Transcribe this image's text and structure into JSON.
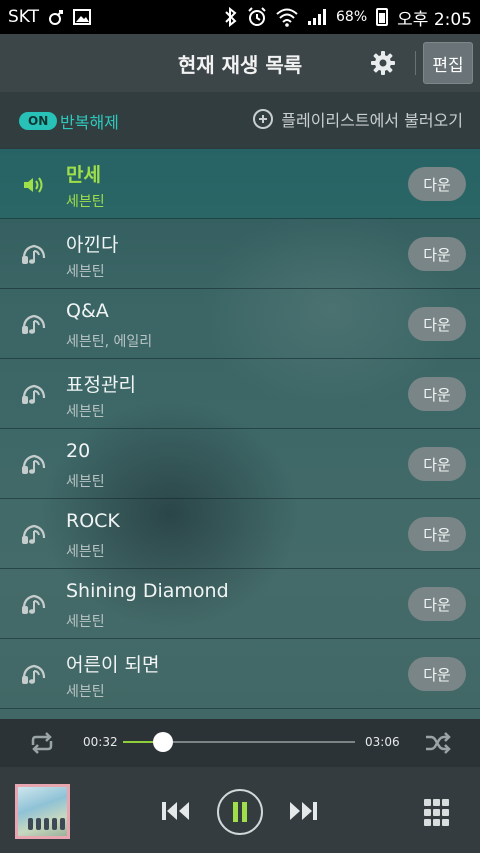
{
  "status_bar": {
    "carrier": "SKT",
    "battery": "68%",
    "time": "오후 2:05"
  },
  "header": {
    "title": "현재 재생 목록",
    "edit_label": "편집",
    "settings_icon": "gear-icon"
  },
  "options": {
    "repeat_on_badge": "ON",
    "repeat_label": "반복해제",
    "load_playlist_label": "플레이리스트에서 불러오기"
  },
  "tracks": [
    {
      "title": "만세",
      "artist": "세븐틴",
      "down_label": "다운",
      "active": true
    },
    {
      "title": "아낀다",
      "artist": "세븐틴",
      "down_label": "다운",
      "active": false
    },
    {
      "title": "Q&A",
      "artist": "세븐틴, 에일리",
      "down_label": "다운",
      "active": false
    },
    {
      "title": "표정관리",
      "artist": "세븐틴",
      "down_label": "다운",
      "active": false
    },
    {
      "title": "20",
      "artist": "세븐틴",
      "down_label": "다운",
      "active": false
    },
    {
      "title": "ROCK",
      "artist": "세븐틴",
      "down_label": "다운",
      "active": false
    },
    {
      "title": "Shining Diamond",
      "artist": "세븐틴",
      "down_label": "다운",
      "active": false
    },
    {
      "title": "어른이 되면",
      "artist": "세븐틴",
      "down_label": "다운",
      "active": false
    }
  ],
  "progress": {
    "current_time": "00:32",
    "total_time": "03:06",
    "fraction": 0.172
  },
  "colors": {
    "accent_green": "#9fe04a",
    "accent_teal": "#27c1b7"
  }
}
